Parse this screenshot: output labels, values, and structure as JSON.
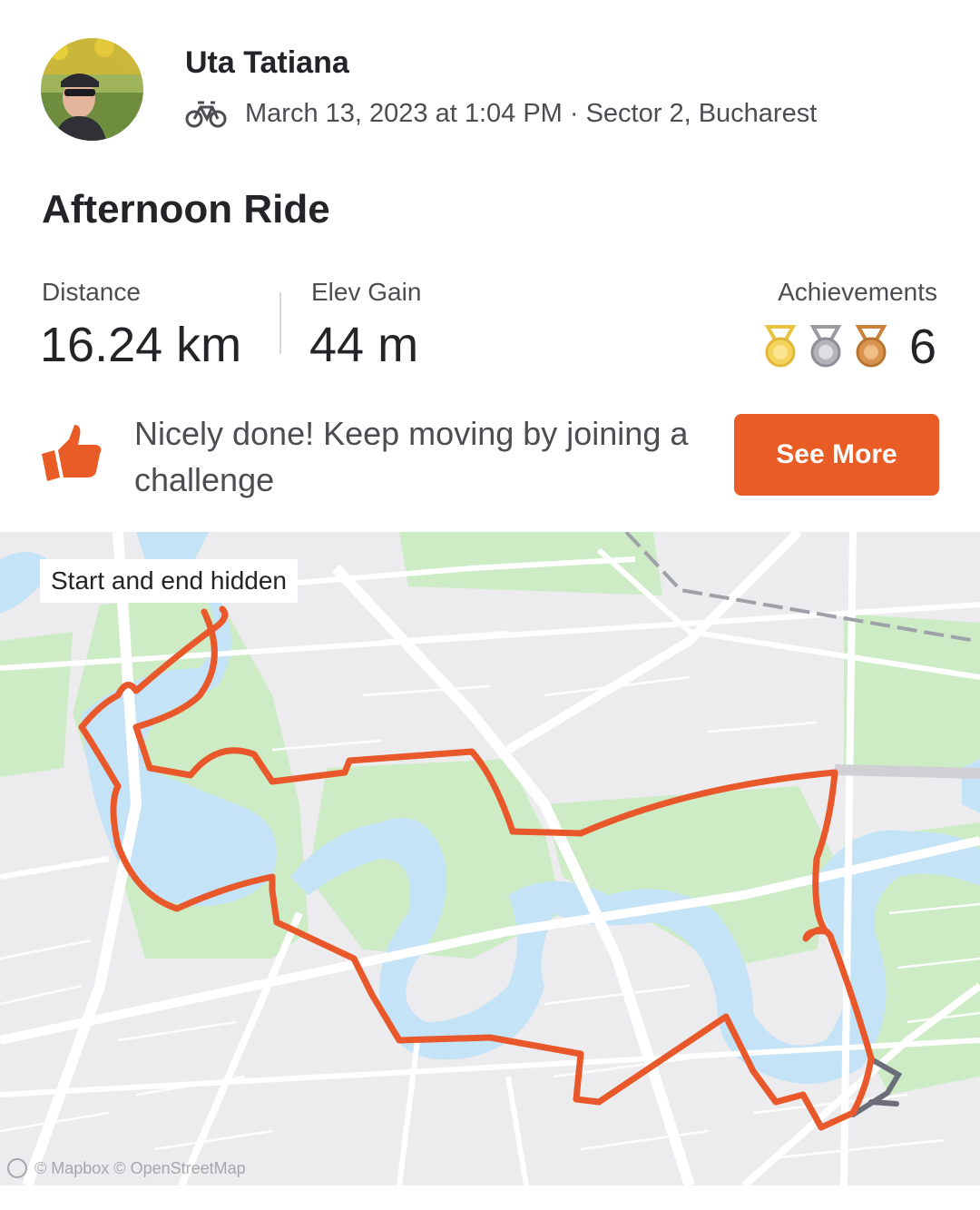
{
  "athlete": {
    "name": "Uta Tatiana",
    "avatar_icon": "avatar-photo"
  },
  "activity": {
    "sport_icon": "bike-icon",
    "datetime_location": "March 13, 2023 at 1:04 PM · Sector 2, Bucharest",
    "title": "Afternoon Ride"
  },
  "stats": {
    "distance_label": "Distance",
    "distance_value": "16.24 km",
    "elev_label": "Elev Gain",
    "elev_value": "44 m",
    "achievements_label": "Achievements",
    "achievements_count": "6",
    "medals": [
      "gold-medal-icon",
      "silver-medal-icon",
      "bronze-medal-icon"
    ]
  },
  "prompt": {
    "icon": "thumbs-up-icon",
    "text": "Nicely done! Keep moving by joining a challenge",
    "button_label": "See More"
  },
  "map": {
    "privacy_note": "Start and end hidden",
    "attribution": "© Mapbox © OpenStreetMap",
    "route_color": "#e8582a",
    "hidden_segment_color": "#6b6e78",
    "water_color": "#c4e3f7",
    "park_color": "#cdecc6"
  },
  "colors": {
    "accent": "#ea5c25",
    "text": "#242428",
    "muted": "#4c4c52"
  }
}
